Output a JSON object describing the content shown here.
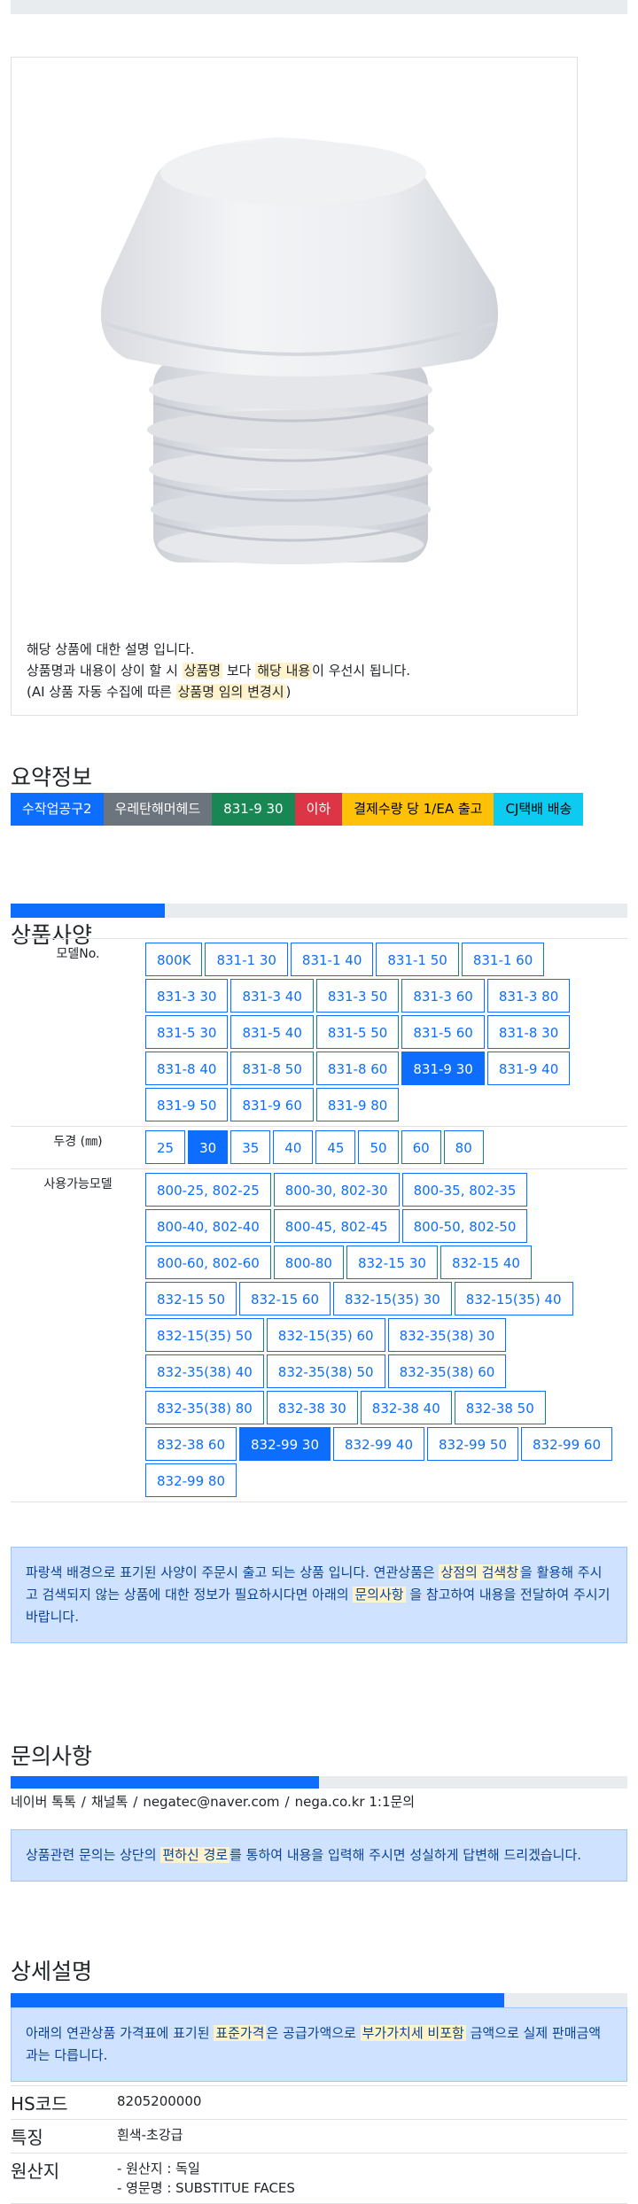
{
  "product": {
    "description_lines": [
      "해당 상품에 대한 설명 입니다.",
      {
        "pre": "상품명과 내용이 상이 할 시 ",
        "hl1": "상품명",
        "mid": " 보다 ",
        "hl2": "해당 내용",
        "post": "이 우선시 됩니다."
      },
      {
        "pre": "(AI 상품 자동 수집에 따른 ",
        "hl": "상품명 임의 변경시",
        "post": ")"
      }
    ]
  },
  "summary": {
    "title": "요약정보",
    "badges": [
      {
        "label": "수작업공구2",
        "color": "#0d6efd",
        "text_color": "#ffffff"
      },
      {
        "label": "우레탄해머헤드",
        "color": "#6c757d",
        "text_color": "#ffffff"
      },
      {
        "label": "831-9 30",
        "color": "#198754",
        "text_color": "#ffffff"
      },
      {
        "label": "이하",
        "color": "#dc3545",
        "text_color": "#ffffff"
      },
      {
        "label": "결제수량 당 1/EA 출고",
        "color": "#ffc107",
        "text_color": "#000000"
      },
      {
        "label": "CJ택배 배송",
        "color": "#0dcaf0",
        "text_color": "#000000"
      }
    ]
  },
  "spec": {
    "title": "상품사양",
    "progress": 0.25,
    "rows": [
      {
        "label": "모델No.",
        "options": [
          "800K",
          "831-1 30",
          "831-1 40",
          "831-1 50",
          "831-1 60",
          "831-3 30",
          "831-3 40",
          "831-3 50",
          "831-3 60",
          "831-3 80",
          "831-5 30",
          "831-5 40",
          "831-5 50",
          "831-5 60",
          "831-8 30",
          "831-8 40",
          "831-8 50",
          "831-8 60",
          "831-9 30",
          "831-9 40",
          "831-9 50",
          "831-9 60",
          "831-9 80"
        ],
        "selected": "831-9 30"
      },
      {
        "label": "두경 (㎜)",
        "options": [
          "25",
          "30",
          "35",
          "40",
          "45",
          "50",
          "60",
          "80"
        ],
        "selected": "30"
      },
      {
        "label": "사용가능모델",
        "options": [
          "800-25, 802-25",
          "800-30, 802-30",
          "800-35, 802-35",
          "800-40, 802-40",
          "800-45, 802-45",
          "800-50, 802-50",
          "800-60, 802-60",
          "800-80",
          "832-15 30",
          "832-15 40",
          "832-15 50",
          "832-15 60",
          "832-15(35) 30",
          "832-15(35) 40",
          "832-15(35) 50",
          "832-15(35) 60",
          "832-35(38) 30",
          "832-35(38) 40",
          "832-35(38) 50",
          "832-35(38) 60",
          "832-35(38) 80",
          "832-38 30",
          "832-38 40",
          "832-38 50",
          "832-38 60",
          "832-99 30",
          "832-99 40",
          "832-99 50",
          "832-99 60",
          "832-99 80"
        ],
        "selected": "832-99 30"
      }
    ],
    "notice": {
      "pre": "파랑색 배경으로 표기된 사양이 주문시 출고 되는 상품 입니다. 연관상품은 ",
      "hl1": "상점의 검색창",
      "mid": "을 활용해 주시고 검색되지 않는 상품에 대한 정보가 필요하시다면 아래의 ",
      "hl2": "문의사항",
      "post": " 을 참고하여 내용을 전달하여 주시기 바랍니다."
    }
  },
  "inquiry": {
    "title": "문의사항",
    "progress": 0.5,
    "links": [
      "네이버 톡톡",
      "채널톡",
      "negatec@naver.com",
      "nega.co.kr 1:1문의"
    ],
    "separator": "/",
    "notice": {
      "pre": "상품관련 문의는 상단의 ",
      "hl": "편하신 경로",
      "post": "를 통하여 내용을 입력해 주시면 성실하게 답변해 드리겠습니다."
    }
  },
  "detail": {
    "title": "상세설명",
    "progress": 0.8,
    "notice": {
      "pre": "아래의 연관상품 가격표에 표기된 ",
      "hl1": "표준가격",
      "mid": "은 공급가액으로 ",
      "hl2": "부가가치세 비포함",
      "post": " 금액으로 실제 판매금액과는 다릅니다."
    },
    "rows": [
      {
        "label": "HS코드",
        "values": [
          "8205200000"
        ]
      },
      {
        "label": "특징",
        "values": [
          "흰색-초강급"
        ]
      },
      {
        "label": "원산지",
        "values": [
          "- 원산지 : 독일",
          "- 영문명 : SUBSTITUE FACES"
        ]
      }
    ]
  }
}
